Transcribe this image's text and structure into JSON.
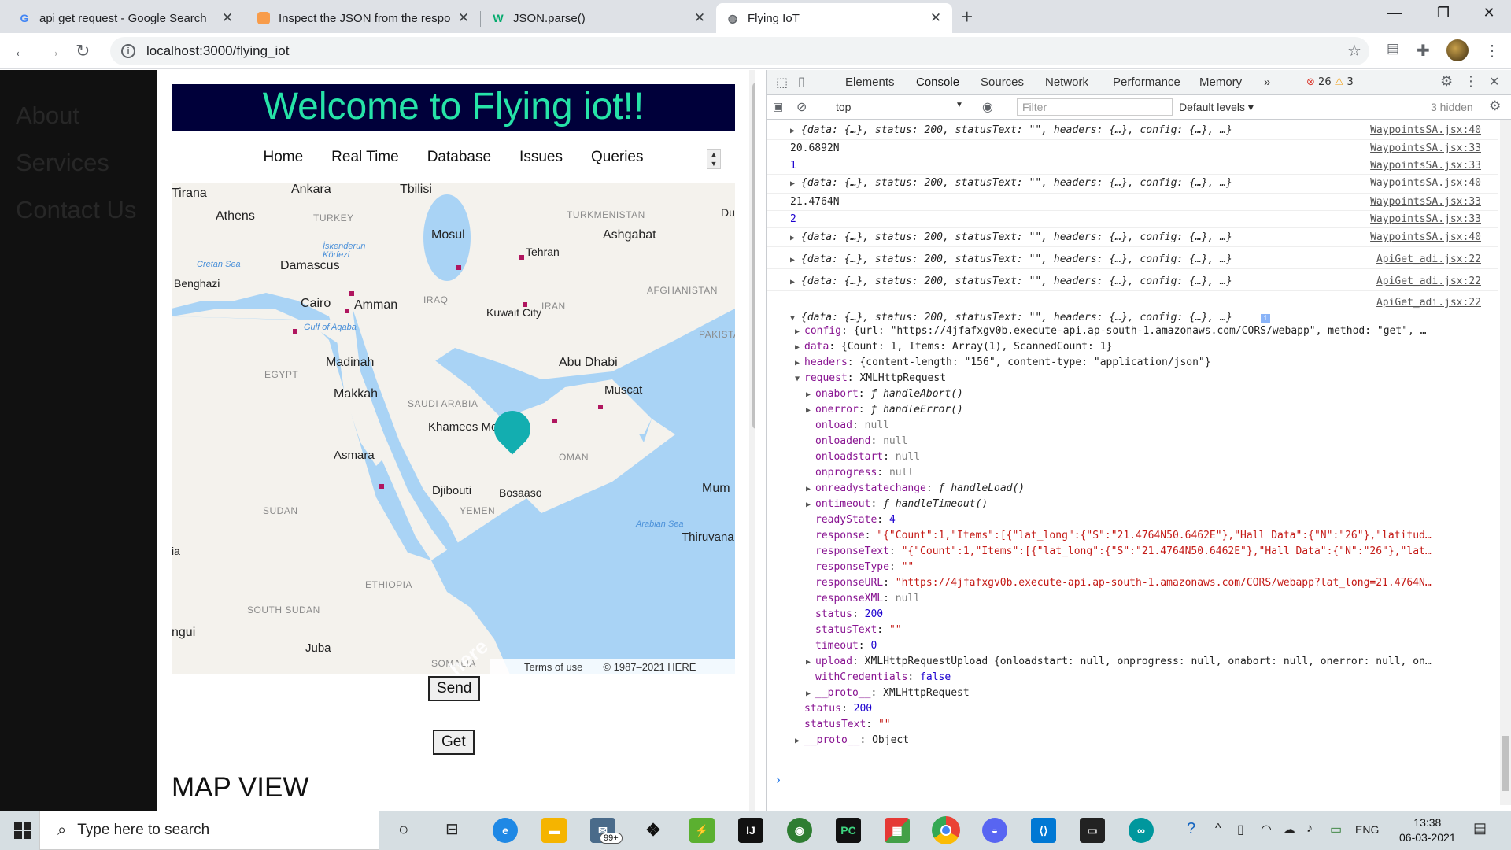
{
  "browser": {
    "tabs": [
      {
        "title": "api get request - Google Search",
        "icon": "google-icon"
      },
      {
        "title": "Inspect the JSON from the respo",
        "icon": "stackby-icon"
      },
      {
        "title": "JSON.parse()",
        "icon": "w3-icon"
      },
      {
        "title": "Flying IoT",
        "icon": "globe-icon"
      }
    ],
    "url": "localhost:3000/flying_iot"
  },
  "sidenav": {
    "items": [
      "About",
      "Services",
      "Contact Us"
    ]
  },
  "page": {
    "heading": "Welcome to Flying iot!!",
    "menu": [
      "Home",
      "Real Time",
      "Database",
      "Issues",
      "Queries"
    ],
    "send_label": "Send",
    "get_label": "Get",
    "map_view_title": "MAP VIEW"
  },
  "map": {
    "places": [
      "Tirana",
      "Ankara",
      "Tbilisi",
      "Athens",
      "Mosul",
      "Ashgabat",
      "Tehran",
      "Damascus",
      "Benghazi",
      "Cairo",
      "Amman",
      "Kuwait City",
      "Madinah",
      "Abu Dhabi",
      "Makkah",
      "Muscat",
      "Khamees Moshait",
      "Asmara",
      "Djibouti",
      "Bosaaso",
      "Juba",
      "Thiruvana",
      "Mum",
      "Du",
      "ngui",
      "ia"
    ],
    "regions": [
      "TURKEY",
      "TURKMENISTAN",
      "IRAQ",
      "IRAN",
      "AFGHANISTAN",
      "PAKISTA",
      "EGYPT",
      "SAUDI ARABIA",
      "OMAN",
      "SUDAN",
      "YEMEN",
      "ETHIOPIA",
      "SOUTH SUDAN",
      "SOMALIA"
    ],
    "waters": [
      "Cretan Sea",
      "Gulf of Aqaba",
      "Arabian Sea",
      "İskenderun Körfezi"
    ],
    "terms": "Terms of use",
    "copyright": "© 1987–2021 HERE",
    "logo": "here"
  },
  "devtools": {
    "tabs": [
      "Elements",
      "Console",
      "Sources",
      "Network",
      "Performance",
      "Memory"
    ],
    "more": "»",
    "errors": "26",
    "warnings": "3",
    "context": "top",
    "filter_placeholder": "Filter",
    "levels": "Default levels ▾",
    "hidden": "3 hidden",
    "logs": [
      {
        "text": "{data: {…}, status: 200, statusText: \"\", headers: {…}, config: {…}, …}",
        "source": "WaypointsSA.jsx:40",
        "expandable": true
      },
      {
        "text": "20.6892N",
        "source": "WaypointsSA.jsx:33",
        "expandable": false
      },
      {
        "text": "1",
        "source": "WaypointsSA.jsx:33",
        "expandable": false,
        "number": true
      },
      {
        "text": "{data: {…}, status: 200, statusText: \"\", headers: {…}, config: {…}, …}",
        "source": "WaypointsSA.jsx:40",
        "expandable": true
      },
      {
        "text": "21.4764N",
        "source": "WaypointsSA.jsx:33",
        "expandable": false
      },
      {
        "text": "2",
        "source": "WaypointsSA.jsx:33",
        "expandable": false,
        "number": true
      },
      {
        "text": "{data: {…}, status: 200, statusText: \"\", headers: {…}, config: {…}, …}",
        "source": "WaypointsSA.jsx:40",
        "expandable": true
      },
      {
        "text": "{data: {…}, status: 200, statusText: \"\", headers: {…}, config: {…}, …}",
        "source": "ApiGet_adi.jsx:22",
        "expandable": true
      },
      {
        "text": "{data: {…}, status: 200, statusText: \"\", headers: {…}, config: {…}, …}",
        "source": "ApiGet_adi.jsx:22",
        "expandable": true
      },
      {
        "text": "",
        "source": "ApiGet_adi.jsx:22",
        "expandable": false
      }
    ],
    "expanded_header": "{data: {…}, status: 200, statusText: \"\", headers: {…}, config: {…}, …}",
    "expanded": [
      {
        "indent": 1,
        "arrow": "▶",
        "key": "config",
        "value": "{url: \"https://4jfafxgv0b.execute-api.ap-south-1.amazonaws.com/CORS/webapp\", method: \"get\", …"
      },
      {
        "indent": 1,
        "arrow": "▶",
        "key": "data",
        "value": "{Count: 1, Items: Array(1), ScannedCount: 1}"
      },
      {
        "indent": 1,
        "arrow": "▶",
        "key": "headers",
        "value": "{content-length: \"156\", content-type: \"application/json\"}"
      },
      {
        "indent": 1,
        "arrow": "▼",
        "key": "request",
        "value": "XMLHttpRequest"
      },
      {
        "indent": 2,
        "arrow": "▶",
        "key": "onabort",
        "value": "ƒ handleAbort()"
      },
      {
        "indent": 2,
        "arrow": "▶",
        "key": "onerror",
        "value": "ƒ handleError()"
      },
      {
        "indent": 2,
        "arrow": "",
        "key": "onload",
        "value": "null"
      },
      {
        "indent": 2,
        "arrow": "",
        "key": "onloadend",
        "value": "null"
      },
      {
        "indent": 2,
        "arrow": "",
        "key": "onloadstart",
        "value": "null"
      },
      {
        "indent": 2,
        "arrow": "",
        "key": "onprogress",
        "value": "null"
      },
      {
        "indent": 2,
        "arrow": "▶",
        "key": "onreadystatechange",
        "value": "ƒ handleLoad()"
      },
      {
        "indent": 2,
        "arrow": "▶",
        "key": "ontimeout",
        "value": "ƒ handleTimeout()"
      },
      {
        "indent": 2,
        "arrow": "",
        "key": "readyState",
        "value": "4"
      },
      {
        "indent": 2,
        "arrow": "",
        "key": "response",
        "value": "\"{\"Count\":1,\"Items\":[{\"lat_long\":{\"S\":\"21.4764N50.6462E\"},\"Hall Data\":{\"N\":\"26\"},\"latitud…"
      },
      {
        "indent": 2,
        "arrow": "",
        "key": "responseText",
        "value": "\"{\"Count\":1,\"Items\":[{\"lat_long\":{\"S\":\"21.4764N50.6462E\"},\"Hall Data\":{\"N\":\"26\"},\"lat…"
      },
      {
        "indent": 2,
        "arrow": "",
        "key": "responseType",
        "value": "\"\""
      },
      {
        "indent": 2,
        "arrow": "",
        "key": "responseURL",
        "value": "\"https://4jfafxgv0b.execute-api.ap-south-1.amazonaws.com/CORS/webapp?lat_long=21.4764N…"
      },
      {
        "indent": 2,
        "arrow": "",
        "key": "responseXML",
        "value": "null"
      },
      {
        "indent": 2,
        "arrow": "",
        "key": "status",
        "value": "200"
      },
      {
        "indent": 2,
        "arrow": "",
        "key": "statusText",
        "value": "\"\""
      },
      {
        "indent": 2,
        "arrow": "",
        "key": "timeout",
        "value": "0"
      },
      {
        "indent": 2,
        "arrow": "▶",
        "key": "upload",
        "value": "XMLHttpRequestUpload {onloadstart: null, onprogress: null, onabort: null, onerror: null, on…"
      },
      {
        "indent": 2,
        "arrow": "",
        "key": "withCredentials",
        "value": "false"
      },
      {
        "indent": 2,
        "arrow": "▶",
        "key": "__proto__",
        "value": "XMLHttpRequest"
      },
      {
        "indent": 1,
        "arrow": "",
        "key": "status",
        "value": "200"
      },
      {
        "indent": 1,
        "arrow": "",
        "key": "statusText",
        "value": "\"\""
      },
      {
        "indent": 1,
        "arrow": "▶",
        "key": "__proto__",
        "value": "Object"
      }
    ]
  },
  "taskbar": {
    "search_placeholder": "Type here to search",
    "mail_badge": "99+",
    "lang": "ENG",
    "time": "13:38",
    "date": "06-03-2021"
  },
  "colors": {
    "hero_bg": "#00003a",
    "hero_text": "#26e3a8",
    "pin": "#13aeb0",
    "map_water": "#a9d3f5"
  }
}
